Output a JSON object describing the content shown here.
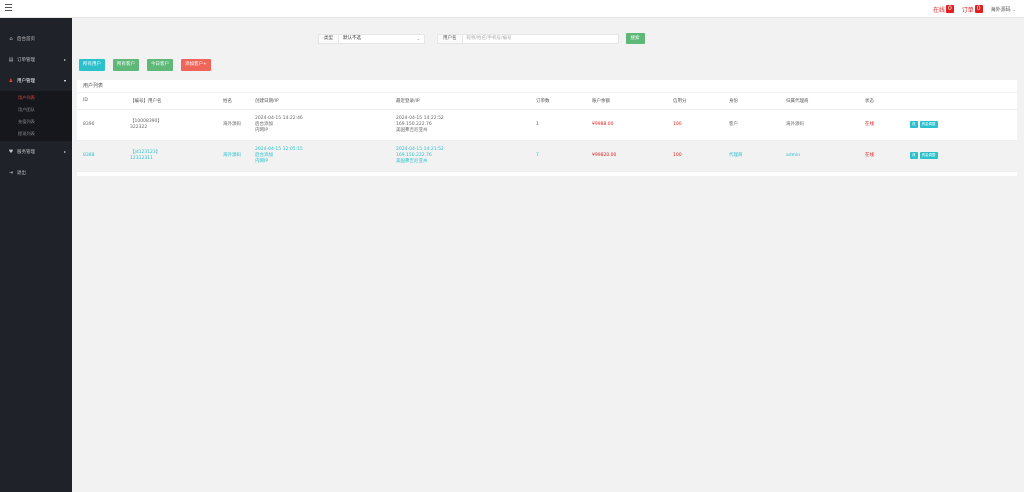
{
  "header": {
    "menu_icon": "hamburger-icon",
    "online_label": "在线",
    "online_count": "0",
    "order_label": "订单",
    "order_count": "0",
    "user_name": "海外源码"
  },
  "sidebar": {
    "items": [
      {
        "label": "后台首页",
        "icon": "home-icon"
      },
      {
        "label": "订单管理",
        "icon": "order-icon"
      },
      {
        "label": "用户管理",
        "icon": "user-icon"
      },
      {
        "label": "服务管理",
        "icon": "service-icon"
      },
      {
        "label": "退出",
        "icon": "logout-icon"
      }
    ],
    "sub_items": [
      "用户列表",
      "用户团队",
      "充值列表",
      "提现列表"
    ]
  },
  "search": {
    "type_label": "类型",
    "type_value": "默认不选",
    "user_label": "用户名",
    "user_placeholder": "昵称/姓名/手机号/编号",
    "search_button": "搜索"
  },
  "actions": {
    "all_users": "所有用户",
    "all_clients": "所有客户",
    "today_clients": "今日客户",
    "add_client": "添加客户+"
  },
  "table": {
    "title": "用户列表",
    "headers": [
      "ID",
      "【编号】用户名",
      "姓名",
      "创建日期/IP",
      "最近登录/IP",
      "订单数",
      "账户余额",
      "信用分",
      "身份",
      "归属代理商",
      "状态",
      ""
    ],
    "rows": [
      {
        "id": "8390",
        "code": "【10008390】",
        "username": "322322",
        "name": "海外源码",
        "created_date": "2024-04-15 14:22:46",
        "created_by": "后台添加",
        "created_ip": "内网IP",
        "login_date": "2024-04-15 14:22:52",
        "login_ip": "169.150.222.76",
        "login_loc": "美国弗吉尼亚州",
        "orders": "1",
        "balance": "¥9988.00",
        "credit": "100",
        "role": "客户",
        "agent": "海外源码",
        "status": "在线",
        "op1": "改",
        "op2": "资金调整"
      },
      {
        "id": "8388",
        "code": "【jd123123】",
        "username": "12312311",
        "name": "海外源码",
        "created_date": "2024-04-15 12:05:15",
        "created_by": "后台添加",
        "created_ip": "内网IP",
        "login_date": "2024-04-15 14:21:52",
        "login_ip": "169.150.222.76",
        "login_loc": "美国弗吉尼亚州",
        "orders": "7",
        "balance": "¥99820.00",
        "credit": "100",
        "role": "代理商",
        "agent": "admin",
        "status": "在线",
        "op1": "改",
        "op2": "资金调整"
      }
    ]
  }
}
